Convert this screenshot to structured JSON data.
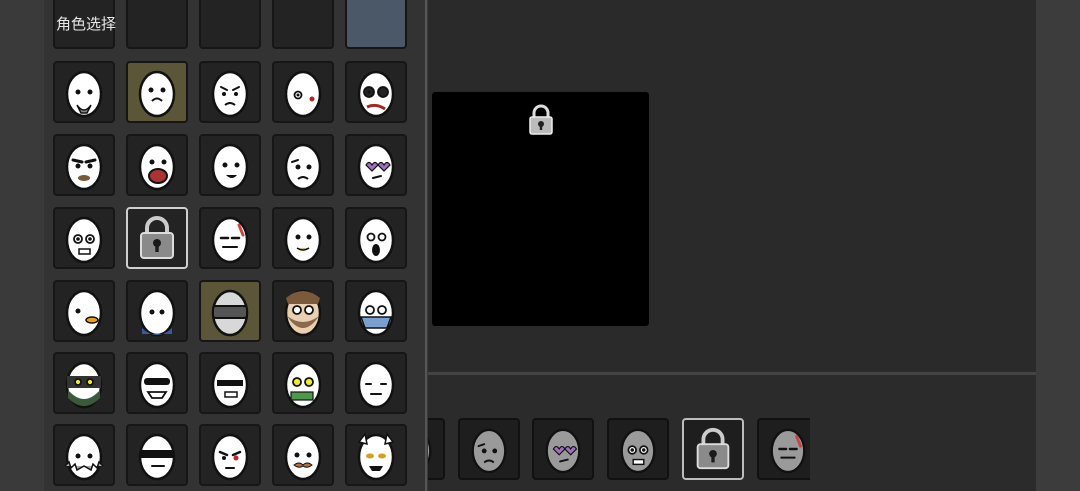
{
  "panel": {
    "title": "角色选择"
  },
  "grid": {
    "partial_top_row": [
      {
        "id": "c0",
        "style": "normal"
      },
      {
        "id": "c1",
        "style": "normal"
      },
      {
        "id": "c2",
        "style": "normal"
      },
      {
        "id": "c3",
        "style": "normal"
      },
      {
        "id": "c4",
        "style": "blueish"
      }
    ],
    "rows": [
      [
        {
          "id": "egg-goatee",
          "face": "goatee",
          "bg": "normal"
        },
        {
          "id": "egg-whiskers",
          "face": "whiskers",
          "bg": "olive"
        },
        {
          "id": "egg-frown",
          "face": "frown",
          "bg": "normal"
        },
        {
          "id": "egg-bloody",
          "face": "bloody",
          "bg": "normal"
        },
        {
          "id": "egg-panda",
          "face": "panda",
          "bg": "normal"
        }
      ],
      [
        {
          "id": "egg-brows",
          "face": "brows",
          "bg": "normal"
        },
        {
          "id": "egg-shout",
          "face": "shout",
          "bg": "normal"
        },
        {
          "id": "egg-smile",
          "face": "smile",
          "bg": "normal"
        },
        {
          "id": "egg-sad",
          "face": "sad",
          "bg": "normal"
        },
        {
          "id": "egg-hearts",
          "face": "hearts",
          "bg": "normal"
        }
      ],
      [
        {
          "id": "egg-stare",
          "face": "stare",
          "bg": "normal"
        },
        {
          "id": "egg-locked",
          "face": "lock",
          "bg": "selected"
        },
        {
          "id": "egg-tired",
          "face": "tired",
          "bg": "normal"
        },
        {
          "id": "egg-sick",
          "face": "sick",
          "bg": "normal"
        },
        {
          "id": "egg-scream",
          "face": "scream",
          "bg": "normal"
        }
      ],
      [
        {
          "id": "egg-duck",
          "face": "duck",
          "bg": "normal"
        },
        {
          "id": "egg-suit",
          "face": "suit",
          "bg": "normal"
        },
        {
          "id": "egg-helmet",
          "face": "helmet",
          "bg": "olive"
        },
        {
          "id": "egg-bearded",
          "face": "bearded",
          "bg": "normal"
        },
        {
          "id": "egg-mask",
          "face": "mask",
          "bg": "normal"
        }
      ],
      [
        {
          "id": "egg-ninja",
          "face": "ninja",
          "bg": "normal"
        },
        {
          "id": "egg-shades",
          "face": "shades",
          "bg": "normal"
        },
        {
          "id": "egg-deal",
          "face": "deal",
          "bg": "normal"
        },
        {
          "id": "egg-money",
          "face": "money",
          "bg": "normal"
        },
        {
          "id": "egg-meh",
          "face": "meh",
          "bg": "normal"
        }
      ],
      [
        {
          "id": "egg-spiked",
          "face": "spiked",
          "bg": "normal"
        },
        {
          "id": "egg-visor",
          "face": "visor",
          "bg": "normal"
        },
        {
          "id": "egg-angry",
          "face": "angry",
          "bg": "normal"
        },
        {
          "id": "egg-mustache",
          "face": "mustache",
          "bg": "normal"
        },
        {
          "id": "egg-horns",
          "face": "horns",
          "bg": "normal"
        }
      ]
    ]
  },
  "preview": {
    "locked": true,
    "icon": "lock-icon"
  },
  "bottom_strip": [
    {
      "id": "b0",
      "face": "tired",
      "selected": false
    },
    {
      "id": "b1",
      "face": "sad",
      "selected": false
    },
    {
      "id": "b2",
      "face": "hearts",
      "selected": false
    },
    {
      "id": "b3",
      "face": "stare",
      "selected": false
    },
    {
      "id": "b4",
      "face": "lock",
      "selected": true
    },
    {
      "id": "b5",
      "face": "tired",
      "selected": false
    }
  ],
  "colors": {
    "panel_bg": "#333333",
    "tile_bg": "#232323",
    "tile_olive": "#5b5638",
    "stage_bg": "#2a2a2a"
  }
}
